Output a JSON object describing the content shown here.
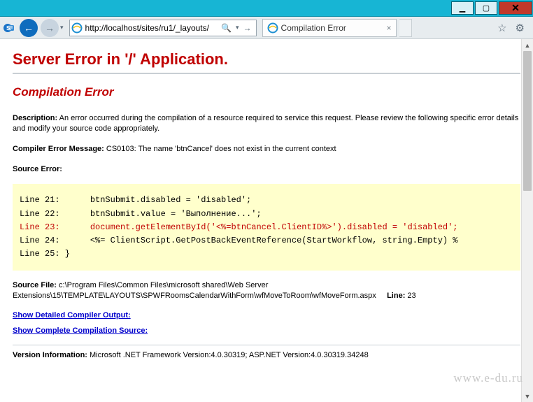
{
  "window": {
    "min_glyph": "▁",
    "max_glyph": "▢",
    "close_glyph": "✕"
  },
  "nav": {
    "back_glyph": "←",
    "fwd_glyph": "→",
    "dropdown_glyph": "▾",
    "url": "http://localhost/sites/ru1/_layouts/",
    "search_glyph": "🔍",
    "arrow_down": "▾",
    "go_glyph": "→"
  },
  "tab": {
    "title": "Compilation Error",
    "close_glyph": "×"
  },
  "toolbar": {
    "star_glyph": "☆",
    "gear_glyph": "⚙"
  },
  "page": {
    "h1": "Server Error in '/' Application.",
    "h2": "Compilation Error",
    "description_label": "Description:",
    "description_text": " An error occurred during the compilation of a resource required to service this request. Please review the following specific error details and modify your source code appropriately.",
    "cem_label": "Compiler Error Message:",
    "cem_text": " CS0103: The name 'btnCancel' does not exist in the current context",
    "source_error_label": "Source Error:",
    "code": {
      "l21": "Line 21:      btnSubmit.disabled = 'disabled';",
      "l22": "Line 22:      btnSubmit.value = 'Выполнение...';",
      "l23": "Line 23:      document.getElementById('<%=btnCancel.ClientID%>').disabled = 'disabled';",
      "l24": "Line 24:      <%= ClientScript.GetPostBackEventReference(StartWorkflow, string.Empty) %",
      "l25": "Line 25: }"
    },
    "source_file_label": "Source File:",
    "source_file_value": " c:\\Program Files\\Common Files\\microsoft shared\\Web Server Extensions\\15\\TEMPLATE\\LAYOUTS\\SPWFRoomsCalendarWithForm\\wfMoveToRoom\\wfMoveForm.aspx",
    "line_label": "Line:",
    "line_value": " 23",
    "link_detailed": "Show Detailed Compiler Output:",
    "link_complete": "Show Complete Compilation Source:",
    "version_label": "Version Information:",
    "version_text": " Microsoft .NET Framework Version:4.0.30319; ASP.NET Version:4.0.30319.34248"
  },
  "watermark": "www.e-du.ru",
  "scroll": {
    "up": "▲",
    "down": "▼"
  }
}
